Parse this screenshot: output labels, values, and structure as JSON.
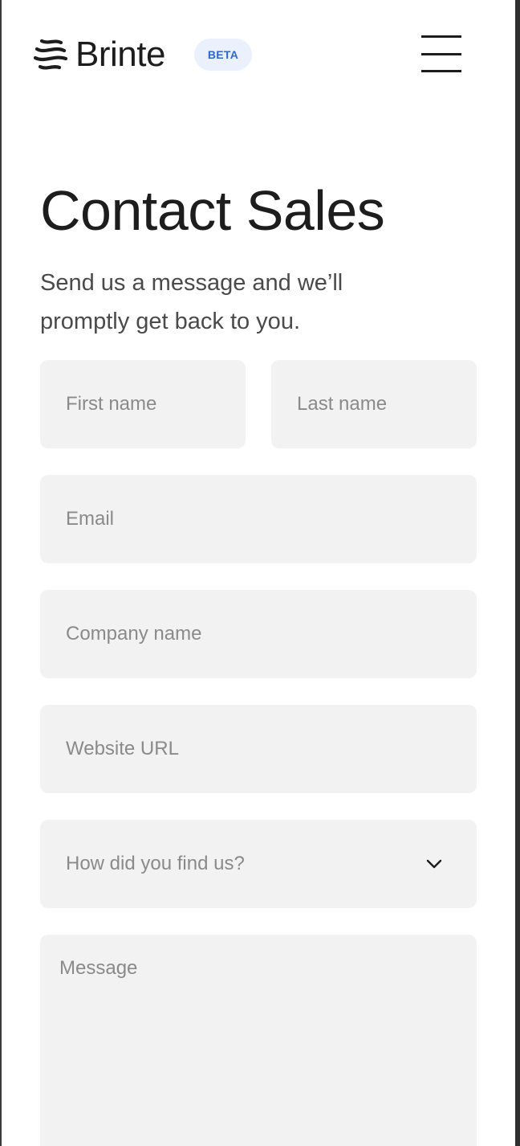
{
  "brand": {
    "name": "Brinte",
    "badge": "BETA",
    "logo_icon": "brinte-wave-logo-icon"
  },
  "nav": {
    "menu_icon": "hamburger-menu-icon"
  },
  "page": {
    "title": "Contact Sales",
    "subtitle": "Send us a message and we’ll promptly get back to you."
  },
  "form": {
    "first_name": {
      "value": "",
      "placeholder": "First name"
    },
    "last_name": {
      "value": "",
      "placeholder": "Last name"
    },
    "email": {
      "value": "",
      "placeholder": "Email"
    },
    "company": {
      "value": "",
      "placeholder": "Company name"
    },
    "website": {
      "value": "",
      "placeholder": "Website URL"
    },
    "source": {
      "selected": "How did you find us?",
      "icon": "chevron-down-icon"
    },
    "message": {
      "value": "",
      "placeholder": "Message"
    }
  },
  "colors": {
    "text": "#1d1d1d",
    "subtext": "#4a4a4a",
    "placeholder": "#8a8a8a",
    "field_bg": "#f2f2f2",
    "badge_bg": "#eaf1fd",
    "badge_text": "#2f66d0"
  }
}
